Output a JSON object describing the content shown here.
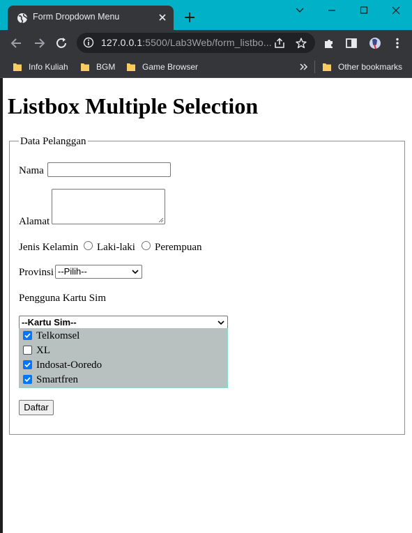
{
  "browser": {
    "tab_title": "Form Dropdown Menu",
    "url_host": "127.0.0.1",
    "url_path": ":5500/Lab3Web/form_listbo...",
    "bookmarks": [
      "Info Kuliah",
      "BGM",
      "Game Browser"
    ],
    "other_bookmarks": "Other bookmarks",
    "accent_color": "#00b1c8"
  },
  "page": {
    "title": "Listbox Multiple Selection",
    "legend": "Data Pelanggan",
    "nama_label": "Nama",
    "nama_value": "",
    "alamat_label": "Alamat",
    "alamat_value": "",
    "jk_label": "Jenis Kelamin",
    "jk_options": [
      "Laki-laki",
      "Perempuan"
    ],
    "provinsi_label": "Provinsi",
    "provinsi_selected": "--Pilih--",
    "kartu_label": "Pengguna Kartu Sim",
    "kartu_dropdown": "--Kartu Sim--",
    "kartu_options": [
      {
        "label": "Telkomsel",
        "checked": true
      },
      {
        "label": "XL",
        "checked": false
      },
      {
        "label": "Indosat-Ooredo",
        "checked": true
      },
      {
        "label": "Smartfren",
        "checked": true
      }
    ],
    "submit_label": "Daftar"
  }
}
